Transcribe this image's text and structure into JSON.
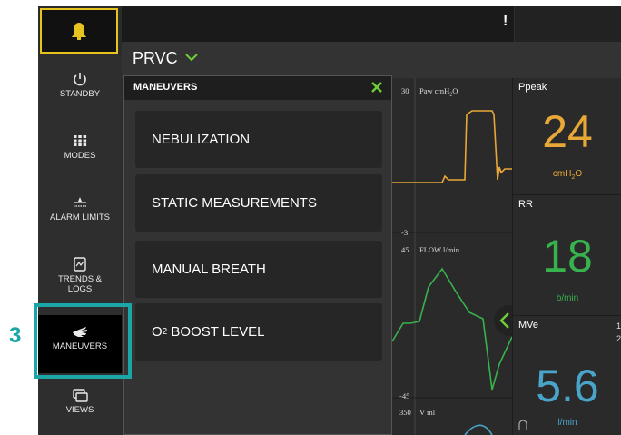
{
  "alarm": {
    "icon": "bell-icon",
    "accent": "#e6c31f"
  },
  "topbar": {
    "alert_mark": "!"
  },
  "mode": {
    "name": "PRVC",
    "icon": "chevron-down-icon"
  },
  "sidebar": {
    "items": [
      {
        "label": "STANDBY",
        "icon": "power-icon"
      },
      {
        "label": "MODES",
        "icon": "grid-icon"
      },
      {
        "label": "ALARM LIMITS",
        "icon": "alarm-limits-icon"
      },
      {
        "label": "TRENDS &",
        "label2": "LOGS",
        "icon": "trends-icon"
      },
      {
        "label": "MANEUVERS",
        "icon": "hand-icon",
        "active": true
      },
      {
        "label": "VIEWS",
        "icon": "views-icon"
      }
    ]
  },
  "maneuvers_panel": {
    "title": "MANEUVERS",
    "close_icon": "close-icon",
    "buttons": [
      {
        "label": "NEBULIZATION"
      },
      {
        "label": "STATIC MEASUREMENTS"
      },
      {
        "label": "MANUAL BREATH"
      },
      {
        "label_prefix": "O",
        "label_sub": "2",
        "label_suffix": " BOOST LEVEL"
      }
    ]
  },
  "waveforms": {
    "paw": {
      "label": "Paw cmH",
      "label_sub": "2",
      "label_end": "O",
      "top": "30",
      "bottom": "-3",
      "color": "#e8a838"
    },
    "flow": {
      "label": "FLOW l/min",
      "top": "45",
      "bottom": "-45",
      "color": "#37b24d"
    },
    "volume": {
      "label": "V ml",
      "top": "350",
      "color": "#4aa3c8"
    }
  },
  "numerics": {
    "ppeak": {
      "label": "Ppeak",
      "value": "24",
      "unit": "cmH",
      "unit_sub": "2",
      "unit_end": "O",
      "color": "#e8a838"
    },
    "rr": {
      "label": "RR",
      "value": "18",
      "unit": "b/min",
      "color": "#37b24d"
    },
    "mve": {
      "label": "MVe",
      "value": "5.6",
      "unit": "l/min",
      "color": "#4aa3c8"
    }
  },
  "edge_labels": {
    "mv_right_1": "1",
    "mv_right_2": "2",
    "loop_icon": "loop-icon"
  },
  "callout": {
    "number": "3",
    "color": "#1aa5a6"
  }
}
